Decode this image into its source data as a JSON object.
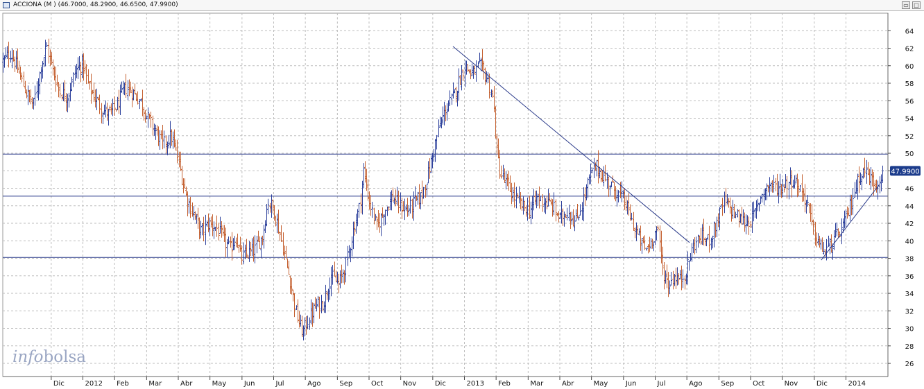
{
  "window": {
    "title": "ACCIONA (M ) (46.7000, 48.2900, 46.6500, 47.9900)",
    "buttons": [
      "restore",
      "maximize"
    ]
  },
  "watermark": {
    "prefix": "info",
    "suffix": "bolsa"
  },
  "colors": {
    "up_bar": "#2b3f9b",
    "down_bar": "#c46030",
    "line": "#2a3a8a",
    "grid": "#bdbdbd",
    "badge": "#1c3c8c"
  },
  "chart_data": {
    "type": "ohlc-bar",
    "title": "ACCIONA (M )",
    "last_price_label": "47.9900",
    "ohlc_last": {
      "open": 46.7,
      "high": 48.29,
      "low": 46.65,
      "close": 47.99
    },
    "y_ticks": [
      26,
      28,
      30,
      32,
      34,
      36,
      38,
      40,
      42,
      44,
      46,
      48,
      50,
      52,
      54,
      56,
      58,
      60,
      62,
      64
    ],
    "ylim": [
      24.5,
      66
    ],
    "x_ticks": [
      {
        "label": "Dic",
        "t": 2011.917
      },
      {
        "label": "2012",
        "t": 2012.0
      },
      {
        "label": "Feb",
        "t": 2012.083
      },
      {
        "label": "Mar",
        "t": 2012.167
      },
      {
        "label": "Abr",
        "t": 2012.25
      },
      {
        "label": "May",
        "t": 2012.333
      },
      {
        "label": "Jun",
        "t": 2012.417
      },
      {
        "label": "Jul",
        "t": 2012.5
      },
      {
        "label": "Ago",
        "t": 2012.583
      },
      {
        "label": "Sep",
        "t": 2012.667
      },
      {
        "label": "Oct",
        "t": 2012.75
      },
      {
        "label": "Nov",
        "t": 2012.833
      },
      {
        "label": "Dic",
        "t": 2012.917
      },
      {
        "label": "2013",
        "t": 2013.0
      },
      {
        "label": "Feb",
        "t": 2013.083
      },
      {
        "label": "Mar",
        "t": 2013.167
      },
      {
        "label": "Abr",
        "t": 2013.25
      },
      {
        "label": "May",
        "t": 2013.333
      },
      {
        "label": "Jun",
        "t": 2013.417
      },
      {
        "label": "Jul",
        "t": 2013.5
      },
      {
        "label": "Ago",
        "t": 2013.583
      },
      {
        "label": "Sep",
        "t": 2013.667
      },
      {
        "label": "Oct",
        "t": 2013.75
      },
      {
        "label": "Nov",
        "t": 2013.833
      },
      {
        "label": "Dic",
        "t": 2013.917
      },
      {
        "label": "2014",
        "t": 2014.0
      }
    ],
    "xlim": [
      2011.79,
      2014.11
    ],
    "horizontal_lines": [
      49.9,
      45.1,
      38.1
    ],
    "trendlines": [
      {
        "from": {
          "t": 2012.97,
          "y": 62.2
        },
        "to": {
          "t": 2013.59,
          "y": 39.8
        }
      },
      {
        "from": {
          "t": 2013.935,
          "y": 37.8
        },
        "to": {
          "t": 2014.087,
          "y": 46.4
        }
      }
    ],
    "price_path": [
      [
        2011.79,
        60.5
      ],
      [
        2011.81,
        61.5
      ],
      [
        2011.83,
        59.5
      ],
      [
        2011.85,
        57.0
      ],
      [
        2011.87,
        55.5
      ],
      [
        2011.89,
        60.0
      ],
      [
        2011.905,
        62.2
      ],
      [
        2011.92,
        59.5
      ],
      [
        2011.94,
        57.0
      ],
      [
        2011.96,
        56.5
      ],
      [
        2011.98,
        59.5
      ],
      [
        2012.0,
        60.2
      ],
      [
        2012.015,
        57.5
      ],
      [
        2012.03,
        56.5
      ],
      [
        2012.05,
        55.0
      ],
      [
        2012.07,
        54.5
      ],
      [
        2012.09,
        55.5
      ],
      [
        2012.11,
        57.5
      ],
      [
        2012.13,
        57.0
      ],
      [
        2012.15,
        56.0
      ],
      [
        2012.17,
        54.0
      ],
      [
        2012.19,
        52.5
      ],
      [
        2012.21,
        51.0
      ],
      [
        2012.23,
        52.0
      ],
      [
        2012.245,
        50.0
      ],
      [
        2012.26,
        47.0
      ],
      [
        2012.275,
        44.5
      ],
      [
        2012.29,
        43.0
      ],
      [
        2012.31,
        41.0
      ],
      [
        2012.33,
        42.0
      ],
      [
        2012.35,
        41.5
      ],
      [
        2012.37,
        40.0
      ],
      [
        2012.385,
        39.0
      ],
      [
        2012.4,
        40.5
      ],
      [
        2012.415,
        38.0
      ],
      [
        2012.43,
        38.5
      ],
      [
        2012.45,
        39.0
      ],
      [
        2012.47,
        40.5
      ],
      [
        2012.485,
        44.5
      ],
      [
        2012.5,
        43.5
      ],
      [
        2012.515,
        41.0
      ],
      [
        2012.53,
        38.0
      ],
      [
        2012.545,
        35.0
      ],
      [
        2012.56,
        31.5
      ],
      [
        2012.575,
        29.5
      ],
      [
        2012.59,
        31.0
      ],
      [
        2012.61,
        32.5
      ],
      [
        2012.63,
        33.0
      ],
      [
        2012.65,
        36.0
      ],
      [
        2012.67,
        35.0
      ],
      [
        2012.69,
        37.5
      ],
      [
        2012.71,
        41.5
      ],
      [
        2012.725,
        44.0
      ],
      [
        2012.735,
        48.0
      ],
      [
        2012.75,
        44.5
      ],
      [
        2012.77,
        41.5
      ],
      [
        2012.79,
        43.5
      ],
      [
        2012.81,
        45.0
      ],
      [
        2012.83,
        44.0
      ],
      [
        2012.85,
        43.5
      ],
      [
        2012.87,
        44.5
      ],
      [
        2012.885,
        45.0
      ],
      [
        2012.9,
        47.0
      ],
      [
        2012.915,
        49.5
      ],
      [
        2012.93,
        52.5
      ],
      [
        2012.95,
        55.0
      ],
      [
        2012.965,
        56.0
      ],
      [
        2012.98,
        57.5
      ],
      [
        2013.0,
        60.0
      ],
      [
        2013.02,
        59.0
      ],
      [
        2013.04,
        60.0
      ],
      [
        2013.06,
        58.5
      ],
      [
        2013.075,
        56.0
      ],
      [
        2013.085,
        50.0
      ],
      [
        2013.095,
        47.5
      ],
      [
        2013.11,
        46.5
      ],
      [
        2013.13,
        45.0
      ],
      [
        2013.15,
        44.0
      ],
      [
        2013.17,
        43.5
      ],
      [
        2013.19,
        45.0
      ],
      [
        2013.21,
        44.5
      ],
      [
        2013.23,
        44.0
      ],
      [
        2013.25,
        42.5
      ],
      [
        2013.27,
        43.5
      ],
      [
        2013.29,
        42.0
      ],
      [
        2013.31,
        44.5
      ],
      [
        2013.33,
        47.5
      ],
      [
        2013.345,
        48.5
      ],
      [
        2013.36,
        47.5
      ],
      [
        2013.38,
        46.5
      ],
      [
        2013.4,
        45.5
      ],
      [
        2013.42,
        44.5
      ],
      [
        2013.44,
        42.0
      ],
      [
        2013.46,
        40.0
      ],
      [
        2013.475,
        39.0
      ],
      [
        2013.49,
        40.0
      ],
      [
        2013.505,
        41.5
      ],
      [
        2013.52,
        36.5
      ],
      [
        2013.535,
        35.0
      ],
      [
        2013.55,
        36.0
      ],
      [
        2013.565,
        35.5
      ],
      [
        2013.58,
        36.5
      ],
      [
        2013.6,
        39.5
      ],
      [
        2013.62,
        40.5
      ],
      [
        2013.64,
        40.0
      ],
      [
        2013.66,
        42.0
      ],
      [
        2013.68,
        44.5
      ],
      [
        2013.7,
        43.5
      ],
      [
        2013.72,
        42.5
      ],
      [
        2013.74,
        42.0
      ],
      [
        2013.76,
        43.0
      ],
      [
        2013.78,
        45.5
      ],
      [
        2013.8,
        46.5
      ],
      [
        2013.82,
        46.0
      ],
      [
        2013.84,
        46.5
      ],
      [
        2013.86,
        47.0
      ],
      [
        2013.88,
        46.0
      ],
      [
        2013.9,
        44.0
      ],
      [
        2013.915,
        41.0
      ],
      [
        2013.93,
        39.5
      ],
      [
        2013.945,
        38.8
      ],
      [
        2013.96,
        39.5
      ],
      [
        2013.975,
        40.5
      ],
      [
        2013.99,
        41.5
      ],
      [
        2014.005,
        43.0
      ],
      [
        2014.02,
        45.5
      ],
      [
        2014.035,
        47.5
      ],
      [
        2014.05,
        48.0
      ],
      [
        2014.065,
        47.0
      ],
      [
        2014.08,
        46.5
      ],
      [
        2014.095,
        47.99
      ]
    ]
  }
}
